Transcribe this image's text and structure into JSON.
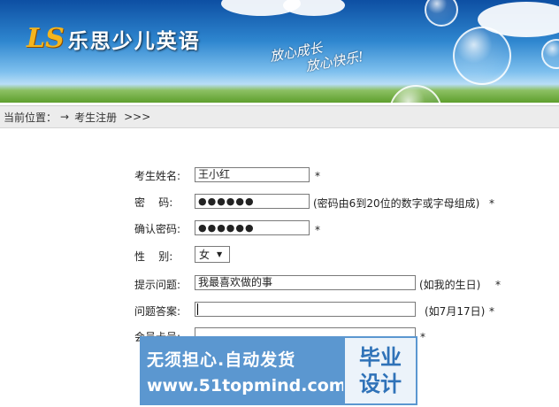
{
  "header": {
    "logo_mark": "LS",
    "logo_name": "乐思少儿英语",
    "slogan_line1": "放心成长",
    "slogan_line2": "放心快乐!"
  },
  "breadcrumb": {
    "prefix": "当前位置：",
    "arrow": "→",
    "current": "考生注册",
    "suffix": ">>>"
  },
  "form": {
    "name_label": "考生姓名:",
    "name_value": "王小红",
    "password_label": "密    码:",
    "password_value": "●●●●●●",
    "password_hint": "(密码由6到20位的数字或字母组成)",
    "confirm_label": "确认密码:",
    "confirm_value": "●●●●●●",
    "gender_label": "性    别:",
    "gender_value": "女",
    "question_label": "提示问题:",
    "question_value": "我最喜欢做的事",
    "question_hint": "(如我的生日)",
    "answer_label": "问题答案:",
    "answer_value": "",
    "answer_hint": "(如7月17日)",
    "card_label": "会员卡号:",
    "card_value": "",
    "required_mark": "*"
  },
  "watermark": {
    "line1": "无须担心.自动发货",
    "line2": "www.51topmind.com",
    "badge_line1": "毕业",
    "badge_line2": "设计"
  }
}
